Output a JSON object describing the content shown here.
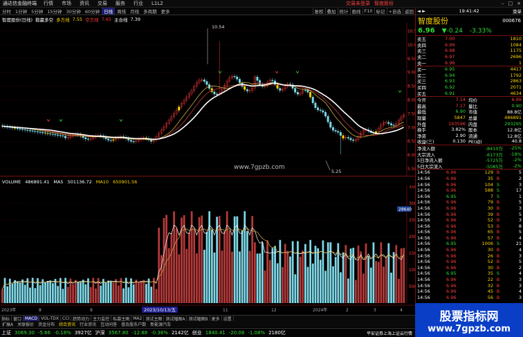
{
  "menu": {
    "logo": "通达信金融终端",
    "items": [
      "行情",
      "市场",
      "资讯",
      "交易",
      "服务",
      "行业",
      "L1L2"
    ],
    "promo1": "交易未登录",
    "promo2": "智度股份",
    "win_controls": [
      "–",
      "□",
      "×"
    ]
  },
  "periods": [
    "分时",
    "1分钟",
    "5分钟",
    "15分钟",
    "30分钟",
    "60分钟",
    "日线",
    "周线",
    "月线",
    "多周期",
    "更多"
  ],
  "period_active": "日线",
  "period_right": [
    "复权",
    "叠加",
    "统计",
    "画线",
    "F10",
    "标记",
    "+自选",
    "返回"
  ],
  "title_line": {
    "stock": "智度股份(日线)",
    "indicator": "稳赢多空",
    "v1_label": "多方线",
    "v1": "7.55",
    "v2_label": "空方线",
    "v2": "7.65",
    "v3_label": "主合线",
    "v3": "7.39"
  },
  "main_axis": [
    "10.50",
    "10.00",
    "9.50",
    "9.00",
    "8.50",
    "8.00",
    "7.50",
    "7.00",
    "6.50",
    "6.00",
    "5.50"
  ],
  "annotations": {
    "high": "10.54",
    "low": "5.25",
    "url": "www.7gpzb.com"
  },
  "vol_line": {
    "label": "VOLUME",
    "vol": "486891.41",
    "ma5_label": "MA5",
    "ma5": "501136.72",
    "ma10_label": "MA10",
    "ma10": "650901.56"
  },
  "vol_axis": [
    "35000",
    "30000",
    "25000",
    "20000",
    "15000",
    "10000",
    "5000"
  ],
  "vol_mid_marker": "28640",
  "x_labels": [
    "2023年",
    "8",
    "9",
    "10",
    "11",
    "12",
    "2024年",
    "2",
    "3",
    "4"
  ],
  "cursor_date": "2023/10/13/五",
  "bottom_tabs": [
    "指标",
    "窗口",
    "MACD",
    "VOL-TDX",
    "CCI",
    "趋势动力",
    "主力监控",
    "私募主图",
    "MA2",
    "测试主图",
    "测试幅图A",
    "测试幅图B",
    "更多",
    "设置"
  ],
  "bottom_tabs2": [
    "扩展A",
    "关联报价",
    "资金分布",
    "综合资讯",
    "行业资讯",
    "互动问答",
    "普及股东户数",
    "新能源汽车"
  ],
  "status": [
    {
      "name": "上证",
      "value": "3069.30",
      "chg": "-5.66",
      "pct": "-0.18%",
      "amt": "3927亿"
    },
    {
      "name": "沪深",
      "value": "3567.80",
      "chg": "-12.88",
      "pct": "-0.36%",
      "amt": "2142亿"
    },
    {
      "name": "创业",
      "value": "1840.41",
      "chg": "-20.08",
      "pct": "-1.08%",
      "amt": "2180亿"
    }
  ],
  "status_right": "平安证券上海上证云行情",
  "right_panel": {
    "top": {
      "left": "◄ ►",
      "time": "19:41:42",
      "menu": "菜单"
    },
    "name": "智度股份",
    "code": "000676",
    "price": "6.96",
    "change": "▼-0.24",
    "pct": "-3.33%",
    "asks": [
      {
        "label": "卖五",
        "price": "7.00",
        "vol": "1810"
      },
      {
        "label": "卖四",
        "price": "6.99",
        "vol": "1084"
      },
      {
        "label": "卖三",
        "price": "6.98",
        "vol": "1175"
      },
      {
        "label": "卖二",
        "price": "6.97",
        "vol": "2696"
      },
      {
        "label": "卖一",
        "price": "6.96",
        "vol": "1"
      }
    ],
    "bids": [
      {
        "label": "买一",
        "price": "6.95",
        "vol": "4417"
      },
      {
        "label": "买二",
        "price": "6.94",
        "vol": "1792"
      },
      {
        "label": "买三",
        "price": "6.93",
        "vol": "2863"
      },
      {
        "label": "买四",
        "price": "6.92",
        "vol": "2071"
      },
      {
        "label": "买五",
        "price": "6.91",
        "vol": "4634"
      }
    ],
    "stats": [
      {
        "l1": "今开",
        "v1": "7.14",
        "l2": "均价",
        "v2": "6.99"
      },
      {
        "l1": "最高",
        "v1": "7.17",
        "l2": "量比",
        "v2": "0.90"
      },
      {
        "l1": "最低",
        "v1": "6.90",
        "l2": "市值",
        "v2": "88.8亿"
      },
      {
        "l1": "现量",
        "v1": "5847",
        "l2": "总量",
        "v2": "486891"
      },
      {
        "l1": "外盘",
        "v1": "193596",
        "l2": "内盘",
        "v2": "293295"
      },
      {
        "l1": "换手",
        "v1": "3.82%",
        "l2": "股本",
        "v2": "12.8亿"
      },
      {
        "l1": "净资",
        "v1": "2.90",
        "l2": "流通",
        "v2": "12.8亿"
      },
      {
        "l1": "收益(三)",
        "v1": "0.130",
        "l2": "PE(动)",
        "v2": "40.8"
      }
    ],
    "flows": [
      {
        "label": "净流入额",
        "value": "-8410万",
        "pct": "-25%"
      },
      {
        "label": "大宗流入",
        "value": "-6173万",
        "pct": "-18%"
      },
      {
        "label": "5日净流入额",
        "value": "-5725万",
        "pct": "-2%"
      },
      {
        "label": "5日大宗流入",
        "value": "-5085万",
        "pct": "-2%"
      }
    ],
    "ticks": [
      {
        "t": "14:56",
        "p": "6.96",
        "v": "129",
        "d": "B",
        "n": "5"
      },
      {
        "t": "14:56",
        "p": "6.96",
        "v": "35",
        "d": "B",
        "n": "2"
      },
      {
        "t": "14:56",
        "p": "6.96",
        "v": "104",
        "d": "S",
        "n": "3"
      },
      {
        "t": "14:56",
        "p": "6.96",
        "v": "588",
        "d": "S",
        "n": "17"
      },
      {
        "t": "14:56",
        "p": "6.95",
        "v": "7",
        "d": "S",
        "n": "1"
      },
      {
        "t": "14:56",
        "p": "6.96",
        "v": "79",
        "d": "B",
        "n": "5"
      },
      {
        "t": "14:56",
        "p": "6.96",
        "v": "30",
        "d": "B",
        "n": "3"
      },
      {
        "t": "14:56",
        "p": "6.96",
        "v": "39",
        "d": "B",
        "n": "5"
      },
      {
        "t": "14:56",
        "p": "6.96",
        "v": "52",
        "d": "B",
        "n": "3"
      },
      {
        "t": "14:56",
        "p": "6.96",
        "v": "53",
        "d": "B",
        "n": "8"
      },
      {
        "t": "14:56",
        "p": "6.96",
        "v": "65",
        "d": "B",
        "n": "5"
      },
      {
        "t": "14:56",
        "p": "6.96",
        "v": "57",
        "d": "B",
        "n": "4"
      },
      {
        "t": "14:56",
        "p": "6.95",
        "v": "1006",
        "d": "S",
        "n": "21"
      },
      {
        "t": "14:56",
        "p": "6.96",
        "v": "30",
        "d": "B",
        "n": "4"
      },
      {
        "t": "14:56",
        "p": "6.96",
        "v": "26",
        "d": "B",
        "n": "3"
      },
      {
        "t": "14:56",
        "p": "6.96",
        "v": "52",
        "d": "B",
        "n": "5"
      },
      {
        "t": "14:56",
        "p": "6.96",
        "v": "30",
        "d": "B",
        "n": "2"
      },
      {
        "t": "14:56",
        "p": "6.95",
        "v": "35",
        "d": "S",
        "n": "4"
      },
      {
        "t": "14:56",
        "p": "6.96",
        "v": "22",
        "d": "B",
        "n": "3"
      },
      {
        "t": "14:56",
        "p": "6.96",
        "v": "32",
        "d": "B",
        "n": "3"
      },
      {
        "t": "14:56",
        "p": "6.96",
        "v": "45",
        "d": "B",
        "n": "4"
      },
      {
        "t": "14:56",
        "p": "6.96",
        "v": "56",
        "d": "B",
        "n": "3"
      }
    ]
  },
  "watermark": {
    "title": "股票指标网",
    "url": "www.7gpzb.com"
  },
  "colors": {
    "up": "#ff3c3c",
    "down": "#33dd33",
    "vol_up": "#b53a3a",
    "vol_down": "#7fd9e8",
    "ma": "#ffffff"
  }
}
